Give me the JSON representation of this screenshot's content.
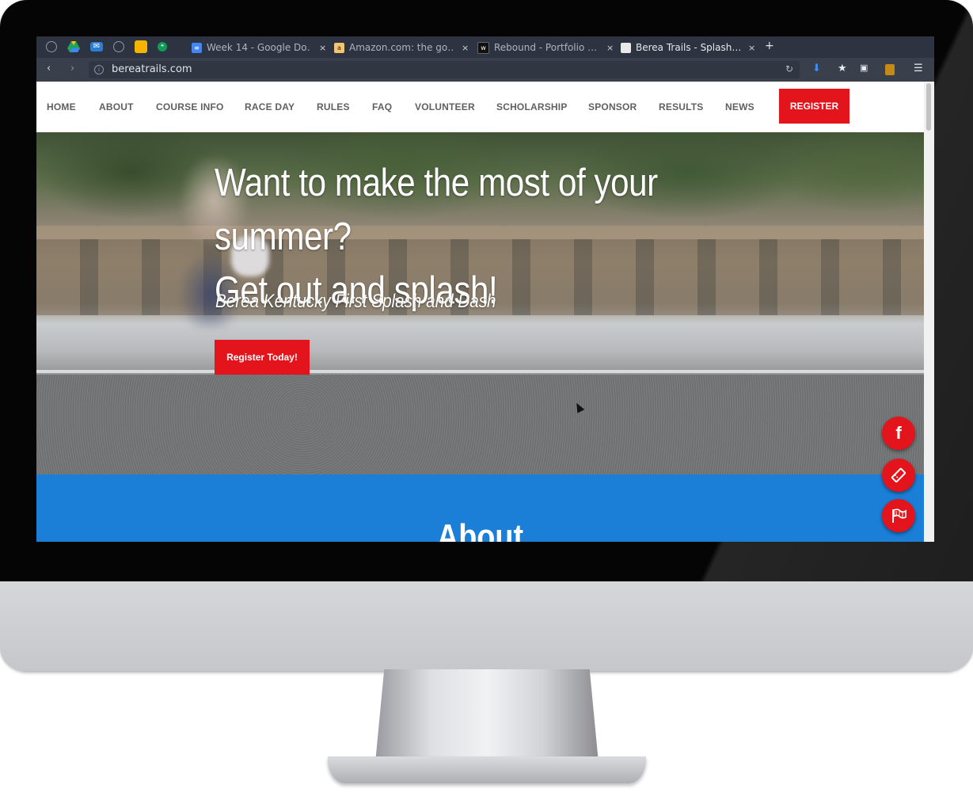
{
  "browser": {
    "pinned_icons": [
      "globe-icon",
      "drive-icon",
      "mail-icon",
      "globe-icon",
      "keep-icon",
      "hangouts-icon"
    ],
    "tabs": [
      {
        "title": "Week 14 - Google Do…",
        "icon": "docs-icon",
        "active": false
      },
      {
        "title": "Amazon.com: the go…",
        "icon": "amazon-icon",
        "active": false
      },
      {
        "title": "Rebound - Portfolio …",
        "icon": "w-icon",
        "active": false
      },
      {
        "title": "Berea Trails - Splash…",
        "icon": "page-icon",
        "active": true
      }
    ],
    "new_tab_label": "+",
    "url": "bereatrails.com"
  },
  "site": {
    "nav": [
      "HOME",
      "ABOUT",
      "COURSE INFO",
      "RACE DAY",
      "RULES",
      "FAQ",
      "VOLUNTEER",
      "SCHOLARSHIP",
      "SPONSOR",
      "RESULTS",
      "NEWS"
    ],
    "register_label": "REGISTER",
    "hero": {
      "title_line1": "Want to make the most of your summer?",
      "title_line2": "Get out and splash!",
      "subtitle": "Berea Kentucky First Splash and Dash",
      "cta_label": "Register Today!"
    },
    "about_title": "About",
    "floating_buttons": [
      "facebook-icon",
      "ticket-icon",
      "flag-icon"
    ]
  },
  "colors": {
    "accent_red": "#e3141b",
    "about_blue": "#1b7fd8",
    "browser_dark": "#2e3341"
  }
}
